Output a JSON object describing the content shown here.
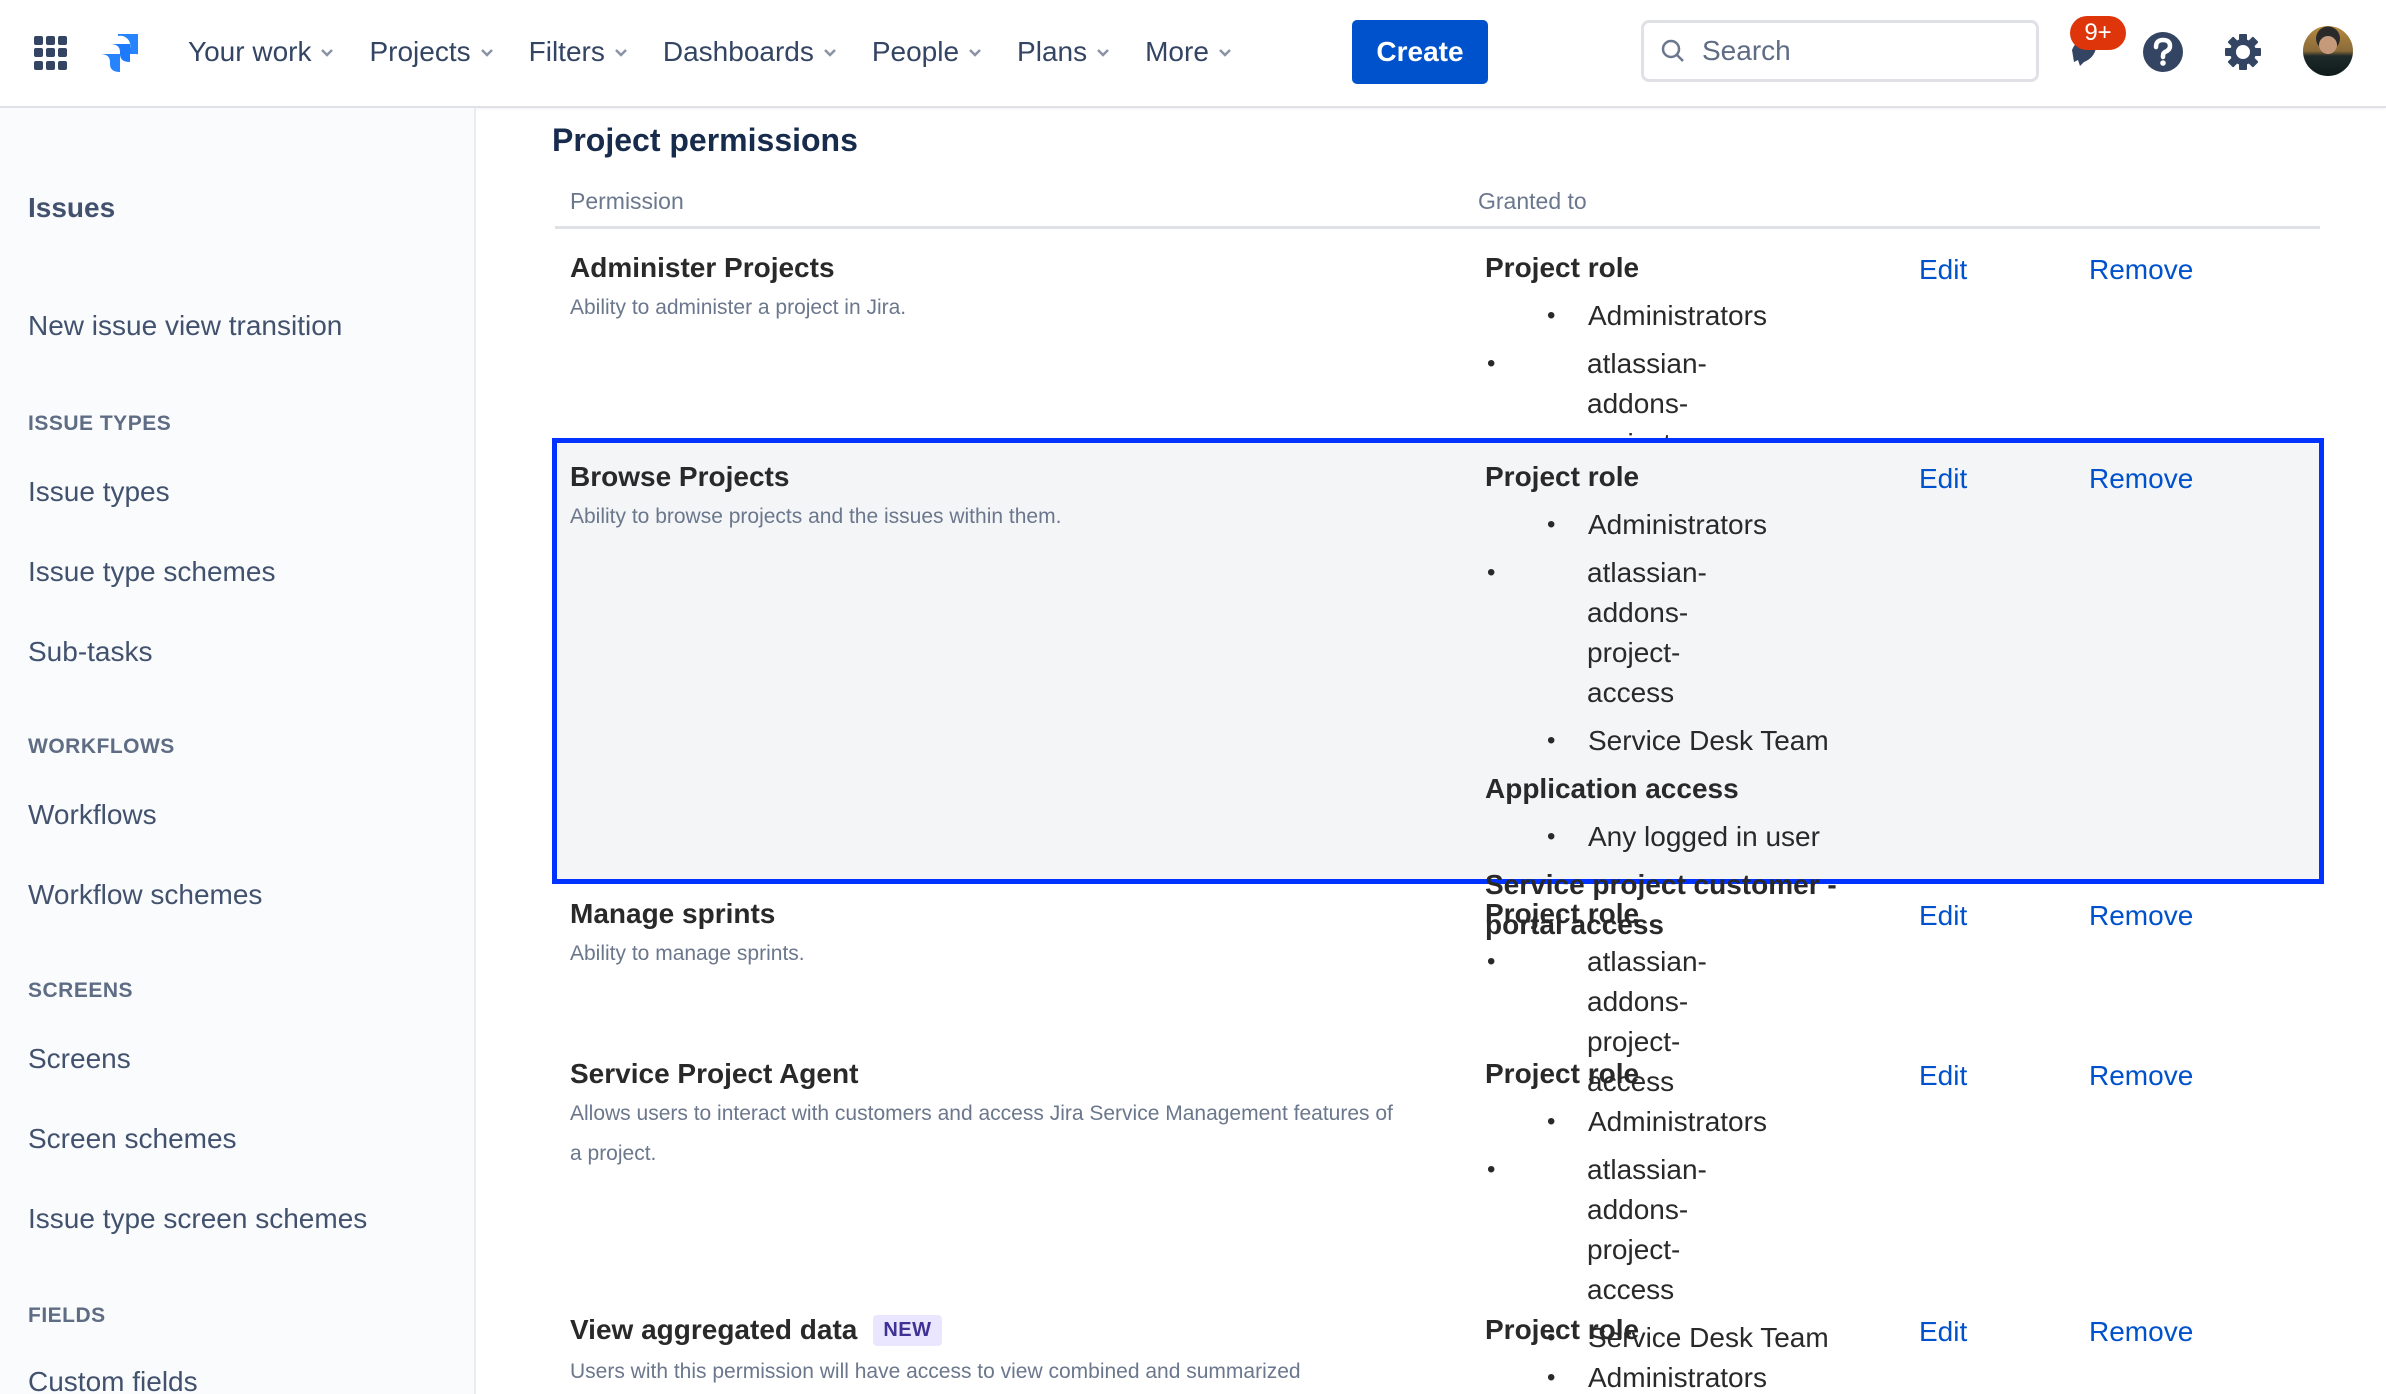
{
  "topbar": {
    "nav": [
      {
        "label": "Your work"
      },
      {
        "label": "Projects"
      },
      {
        "label": "Filters"
      },
      {
        "label": "Dashboards"
      },
      {
        "label": "People"
      },
      {
        "label": "Plans"
      },
      {
        "label": "More"
      }
    ],
    "create_label": "Create",
    "search_placeholder": "Search",
    "notification_count": "9+",
    "icons": [
      "app-switcher-icon",
      "jira-logo",
      "search-icon",
      "notification-bell-icon",
      "help-icon",
      "settings-gear-icon",
      "user-avatar"
    ],
    "colors": {
      "primary": "#0052CC",
      "badge": "#DE350B",
      "highlight_border": "#0033FF"
    }
  },
  "sidebar": {
    "title": "Issues",
    "links_top": [
      {
        "label": "New issue view transition"
      }
    ],
    "sections": [
      {
        "heading": "ISSUE TYPES",
        "items": [
          {
            "label": "Issue types"
          },
          {
            "label": "Issue type schemes"
          },
          {
            "label": "Sub-tasks"
          }
        ]
      },
      {
        "heading": "WORKFLOWS",
        "items": [
          {
            "label": "Workflows"
          },
          {
            "label": "Workflow schemes"
          }
        ]
      },
      {
        "heading": "SCREENS",
        "items": [
          {
            "label": "Screens"
          },
          {
            "label": "Screen schemes"
          },
          {
            "label": "Issue type screen schemes"
          }
        ]
      },
      {
        "heading": "FIELDS",
        "items": [
          {
            "label": "Custom fields"
          }
        ]
      }
    ]
  },
  "main": {
    "title": "Project permissions",
    "columns": {
      "permission": "Permission",
      "granted_to": "Granted to"
    },
    "actions": {
      "edit": "Edit",
      "remove": "Remove"
    },
    "rows": [
      {
        "name": "Administer Projects",
        "description": "Ability to administer a project in Jira.",
        "grants": [
          {
            "type": "Project role",
            "members": [
              "Administrators",
              "atlassian-addons-project-access"
            ]
          }
        ]
      },
      {
        "name": "Browse Projects",
        "description": "Ability to browse projects and the issues within them.",
        "highlighted": true,
        "grants": [
          {
            "type": "Project role",
            "members": [
              "Administrators",
              "atlassian-addons-project-access",
              "Service Desk Team"
            ]
          },
          {
            "type": "Application access",
            "members": [
              "Any logged in user"
            ]
          },
          {
            "type": "Service project customer - portal access",
            "members": []
          }
        ]
      },
      {
        "name": "Manage sprints",
        "description": "Ability to manage sprints.",
        "grants": [
          {
            "type": "Project role",
            "members": [
              "atlassian-addons-project-access"
            ]
          }
        ]
      },
      {
        "name": "Service Project Agent",
        "description": "Allows users to interact with customers and access Jira Service Management features of a project.",
        "grants": [
          {
            "type": "Project role",
            "members": [
              "Administrators",
              "atlassian-addons-project-access",
              "Service Desk Team"
            ]
          }
        ]
      },
      {
        "name": "View aggregated data",
        "badge": "NEW",
        "description": "Users with this permission will have access to view combined and summarized",
        "grants": [
          {
            "type": "Project role",
            "members": [
              "Administrators"
            ]
          }
        ]
      }
    ]
  }
}
